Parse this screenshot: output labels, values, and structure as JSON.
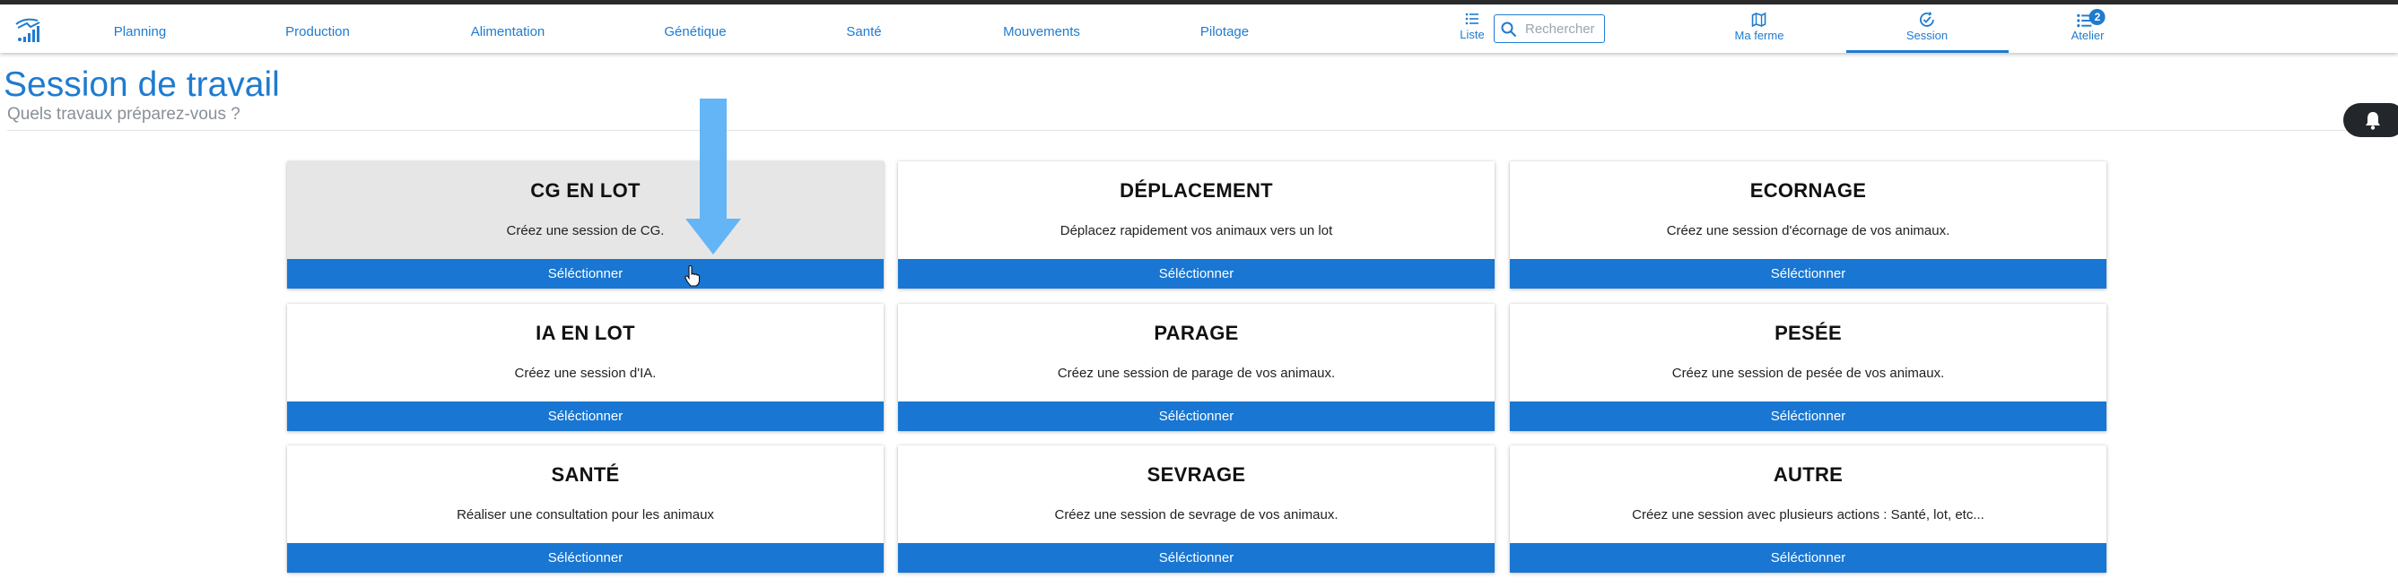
{
  "nav": {
    "items": [
      "Planning",
      "Production",
      "Alimentation",
      "Génétique",
      "Santé",
      "Mouvements",
      "Pilotage"
    ],
    "liste_label": "Liste",
    "search_placeholder": "Rechercher",
    "ma_ferme_label": "Ma ferme",
    "session_label": "Session",
    "atelier_label": "Atelier",
    "atelier_badge": "2",
    "active_item": "Session"
  },
  "page": {
    "title": "Session de travail",
    "subtitle": "Quels travaux préparez-vous ?"
  },
  "cards": [
    {
      "title": "CG EN LOT",
      "description": "Créez une session de CG.",
      "button": "Séléctionner",
      "hovered": true
    },
    {
      "title": "DÉPLACEMENT",
      "description": "Déplacez rapidement vos animaux vers un lot",
      "button": "Séléctionner"
    },
    {
      "title": "ECORNAGE",
      "description": "Créez une session d'écornage de vos animaux.",
      "button": "Séléctionner"
    },
    {
      "title": "IA EN LOT",
      "description": "Créez une session d'IA.",
      "button": "Séléctionner"
    },
    {
      "title": "PARAGE",
      "description": "Créez une session de parage de vos animaux.",
      "button": "Séléctionner"
    },
    {
      "title": "PESÉE",
      "description": "Créez une session de pesée de vos animaux.",
      "button": "Séléctionner"
    },
    {
      "title": "SANTÉ",
      "description": "Réaliser une consultation pour les animaux",
      "button": "Séléctionner"
    },
    {
      "title": "SEVRAGE",
      "description": "Créez une session de sevrage de vos animaux.",
      "button": "Séléctionner"
    },
    {
      "title": "AUTRE",
      "description": "Créez une session avec plusieurs actions : Santé, lot, etc...",
      "button": "Séléctionner"
    }
  ],
  "colors": {
    "accent": "#1e7bd0",
    "button": "#1976d2",
    "arrow": "#64b5f6",
    "hover_card": "#e6e6e6"
  },
  "icons": {
    "logo": "app-logo-icon",
    "liste": "list-icon",
    "search": "search-icon",
    "ma_ferme": "map-icon",
    "session": "session-check-icon",
    "atelier": "list-icon",
    "notification": "bell-icon"
  }
}
